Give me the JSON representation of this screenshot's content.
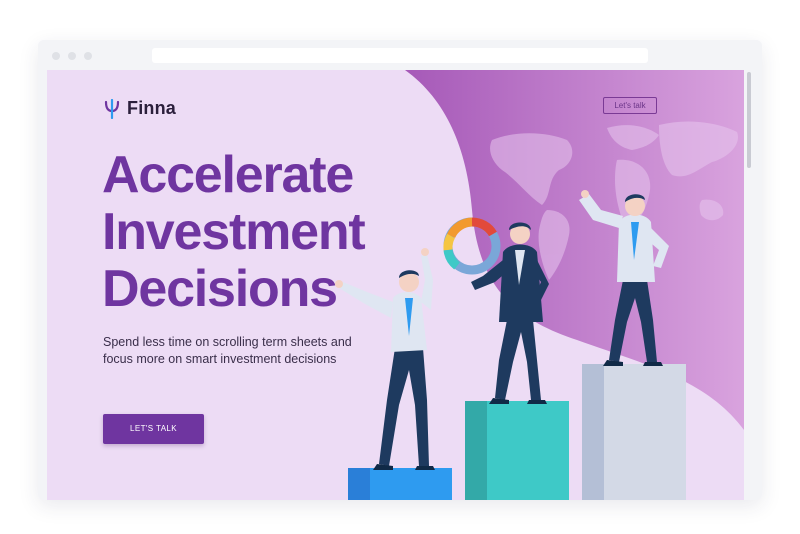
{
  "brand": {
    "name": "Finna",
    "logo_icon": "psi-icon",
    "color": "#6f35a0"
  },
  "nav": {
    "cta_label": "Let's talk"
  },
  "hero": {
    "headline_lines": [
      "Accelerate",
      "Investment",
      "Decisions"
    ],
    "subtext_lines": [
      "Spend less time on scrolling term sheets and",
      "focus more on smart investment decisions"
    ],
    "cta_label": "LET'S TALK"
  },
  "colors": {
    "page_bg": "#eddcf5",
    "wave": "#c07fd0",
    "headline": "#6f35a0",
    "cta_bg": "#6f35a0",
    "podium_blue": "#2e9bf0",
    "podium_teal": "#3ec9c7",
    "podium_grey": "#d3d9e6"
  }
}
